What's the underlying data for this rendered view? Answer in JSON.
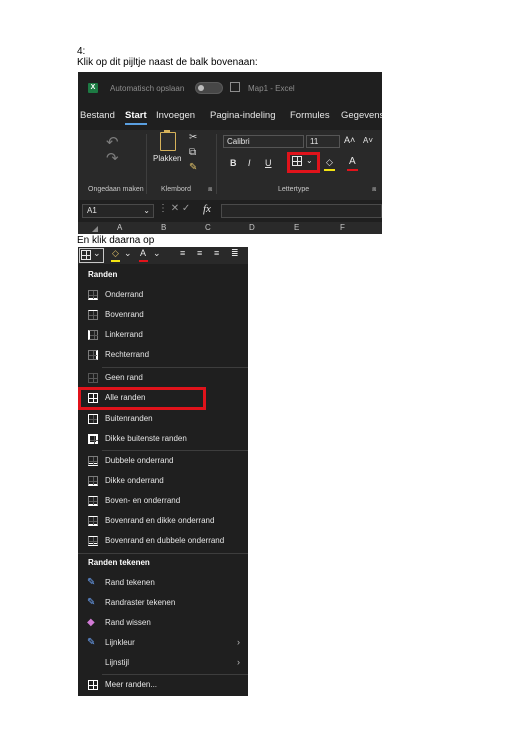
{
  "step_number": "4:",
  "instruction1": "Klik op dit pijltje naast de balk bovenaan:",
  "instruction2": "En klik daarna op",
  "excel": {
    "logo": "X",
    "autosave_label": "Automatisch opslaan",
    "doc_title": "Map1  -  Excel",
    "tabs": [
      "Bestand",
      "Start",
      "Invoegen",
      "Pagina-indeling",
      "Formules",
      "Gegevens"
    ],
    "active_tab": "Start",
    "paste_label": "Plakken",
    "font_name": "Calibri",
    "font_size": "11",
    "grow_font": "A˄",
    "shrink_font": "A˅",
    "bold": "B",
    "italic": "I",
    "underline": "U",
    "font_color_letter": "A",
    "fill_color": "#f2e313",
    "font_color": "#e0131b",
    "group_undo": "Ongedaan maken",
    "group_clipboard": "Klembord",
    "group_font": "Lettertype",
    "name_box": "A1",
    "fx": "fx",
    "columns": [
      "A",
      "B",
      "C",
      "D",
      "E",
      "F"
    ]
  },
  "menu": {
    "toolbar_letter": "A",
    "section_borders": "Randen",
    "items": [
      "Onderrand",
      "Bovenrand",
      "Linkerrand",
      "Rechterrand",
      "Geen rand",
      "Alle randen",
      "Buitenranden",
      "Dikke buitenste randen",
      "Dubbele onderrand",
      "Dikke onderrand",
      "Boven- en onderrand",
      "Bovenrand en dikke onderrand",
      "Bovenrand en dubbele onderrand"
    ],
    "highlighted_item": "Alle randen",
    "section_draw": "Randen tekenen",
    "draw_items": [
      "Rand tekenen",
      "Randraster tekenen",
      "Rand wissen",
      "Lijnkleur",
      "Lijnstijl"
    ],
    "more_borders": "Meer randen...",
    "highlight_color": "#e0131b"
  }
}
